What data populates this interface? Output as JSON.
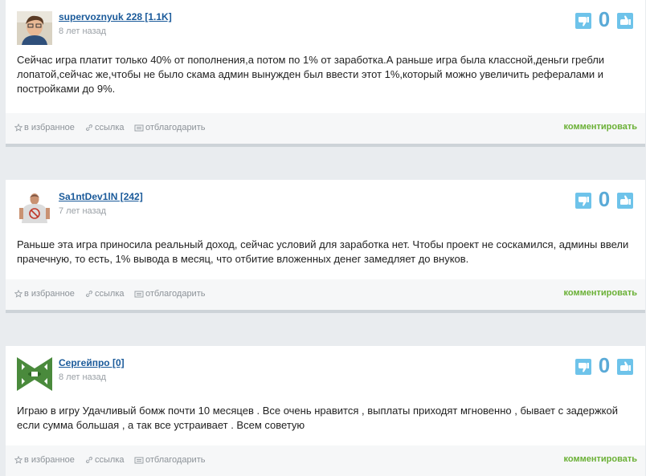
{
  "colors": {
    "page_bg": "#e9ecef",
    "username": "#1a5a9a",
    "vote_button": "#6ec3ea",
    "score": "#5aaad7",
    "comment_link": "#6ab035"
  },
  "icons": {
    "favorite": "star-icon",
    "link": "link-icon",
    "thank": "thank-icon",
    "dislike": "thumbs-down-icon",
    "like": "thumbs-up-icon"
  },
  "actions": {
    "favorite_label": "в избранное",
    "link_label": "ссылка",
    "thank_label": "отблагодарить",
    "comment_label": "комментировать"
  },
  "reviews": [
    {
      "username": "supervoznyuk 228 [1.1K]",
      "time": "8 лет назад",
      "score": "0",
      "text": "Сейчас игра платит только 40% от пополнения,а потом по 1% от заработка.А раньше игра была классной,деньги гребли лопатой,сейчас же,чтобы не было скама админ вынужден был ввести этот 1%,который можно увеличить рефералами и постройками до 9%."
    },
    {
      "username": "Sa1ntDev1lN [242]",
      "time": "7 лет назад",
      "score": "0",
      "text": "Раньше эта игра приносила реальный доход, сейчас условий для заработка нет. Чтобы проект не соскамился, админы ввели прачечную, то есть, 1% вывода в месяц, что отбитие вложенных денег замедляет до внуков."
    },
    {
      "username": "Сергейпро [0]",
      "time": "8 лет назад",
      "score": "0",
      "text": "Играю в игру Удачливый бомж почти 10 месяцев . Все очень нравится , выплаты приходят мгновенно , бывает с задержкой если сумма большая , а так все устраивает . Всем советую"
    }
  ]
}
